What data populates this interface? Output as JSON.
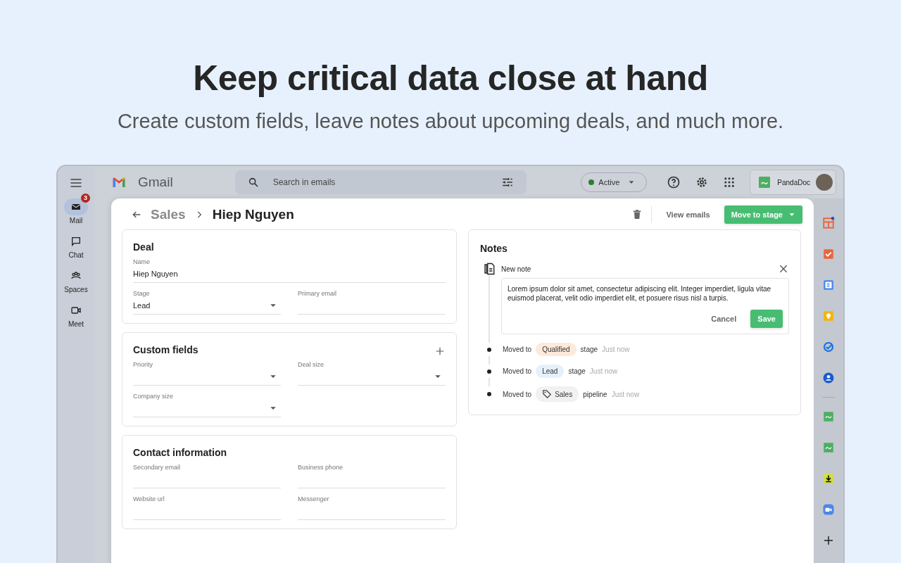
{
  "hero": {
    "title": "Keep critical data close at hand",
    "subtitle": "Create custom fields, leave notes about upcoming deals, and much more."
  },
  "gmail": {
    "logo_text": "Gmail",
    "search": {
      "placeholder": "Search in emails"
    },
    "status": {
      "label": "Active",
      "color": "#2e7d32"
    },
    "addon": {
      "label": "PandaDoc"
    },
    "rail": [
      {
        "label": "Mail",
        "kind": "mail",
        "selected": true,
        "badge": "3"
      },
      {
        "label": "Chat",
        "kind": "chat",
        "selected": false
      },
      {
        "label": "Spaces",
        "kind": "spaces",
        "selected": false
      },
      {
        "label": "Meet",
        "kind": "meet",
        "selected": false
      }
    ]
  },
  "deal_view": {
    "breadcrumb": {
      "parent": "Sales",
      "current": "Hiep Nguyen"
    },
    "view_emails": "View emails",
    "move_to_stage": "Move to stage",
    "sections": [
      {
        "title": "Deal",
        "can_add": false,
        "fields": [
          {
            "label": "Name",
            "value": "Hiep Nguyen",
            "kind": "text",
            "wide": true
          },
          {
            "label": "Stage",
            "value": "Lead",
            "kind": "select",
            "wide": false
          },
          {
            "label": "Primary email",
            "kind": "text",
            "wide": false
          }
        ]
      },
      {
        "title": "Custom fields",
        "can_add": true,
        "fields": [
          {
            "label": "Priority",
            "kind": "select",
            "wide": false
          },
          {
            "label": "Deal size",
            "kind": "select",
            "wide": false
          },
          {
            "label": "Company size",
            "kind": "select",
            "wide": false
          }
        ]
      },
      {
        "title": "Contact information",
        "can_add": false,
        "fields": [
          {
            "label": "Secondary email",
            "kind": "text",
            "wide": false
          },
          {
            "label": "Business phone",
            "kind": "text",
            "wide": false
          },
          {
            "label": "Website url",
            "kind": "text",
            "wide": false
          },
          {
            "label": "Messenger",
            "kind": "text",
            "wide": false
          }
        ]
      }
    ],
    "notes": {
      "title": "Notes",
      "new_note": {
        "label": "New note",
        "text": "Lorem ipsum dolor sit amet, consectetur adipiscing elit. Integer imperdiet, ligula vitae euismod placerat, velit odio imperdiet elit, et posuere risus nisl a turpis.",
        "cancel": "Cancel",
        "save": "Save"
      },
      "history": [
        {
          "prefix": "Moved to",
          "tag": "Qualified",
          "kind": "stage",
          "color": "#fdeadb",
          "suffix": "stage",
          "time": "Just now"
        },
        {
          "prefix": "Moved to",
          "tag": "Lead",
          "kind": "stage",
          "color": "#e6f0fd",
          "suffix": "stage",
          "time": "Just now"
        },
        {
          "prefix": "Moved to",
          "tag": "Sales",
          "kind": "pipeline",
          "color": "#f1f1f1",
          "suffix": "pipeline",
          "time": "Just now"
        }
      ]
    }
  }
}
